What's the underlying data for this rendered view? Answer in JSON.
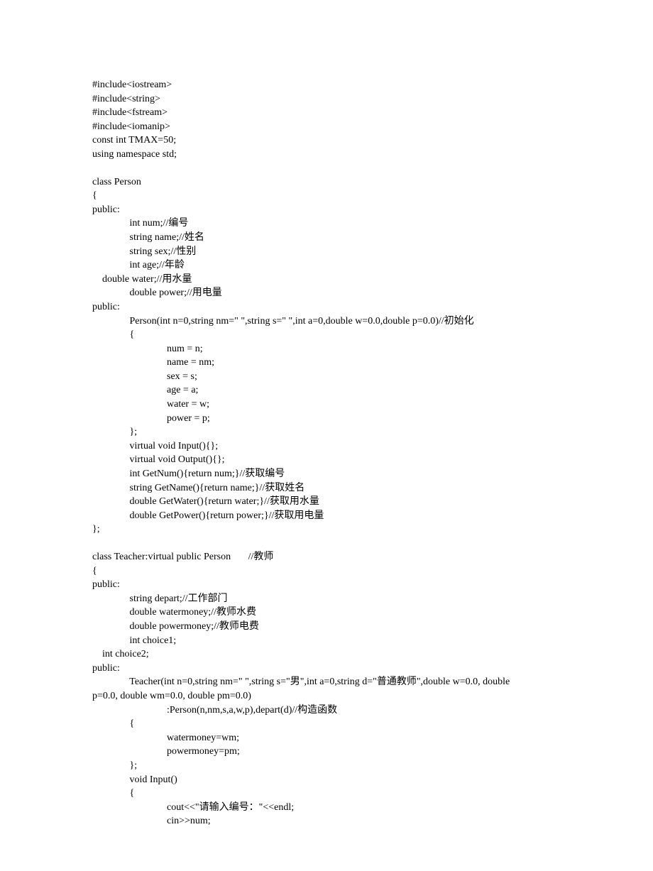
{
  "code_lines": [
    "#include<iostream>",
    "#include<string>",
    "#include<fstream>",
    "#include<iomanip>",
    "const int TMAX=50;",
    "using namespace std;",
    "",
    "class Person",
    "{",
    "public:",
    "               int num;//编号",
    "               string name;//姓名",
    "               string sex;//性别",
    "               int age;//年龄",
    "    double water;//用水量",
    "               double power;//用电量",
    "public:",
    "               Person(int n=0,string nm=\" \",string s=\" \",int a=0,double w=0.0,double p=0.0)//初始化",
    "               {",
    "                              num = n;",
    "                              name = nm;",
    "                              sex = s;",
    "                              age = a;",
    "                              water = w;",
    "                              power = p;",
    "               };",
    "               virtual void Input(){};",
    "               virtual void Output(){};",
    "               int GetNum(){return num;}//获取编号",
    "               string GetName(){return name;}//获取姓名",
    "               double GetWater(){return water;}//获取用水量",
    "               double GetPower(){return power;}//获取用电量",
    "};",
    "",
    "class Teacher:virtual public Person       //教师",
    "{",
    "public:",
    "               string depart;//工作部门",
    "               double watermoney;//教师水费",
    "               double powermoney;//教师电费",
    "               int choice1;",
    "    int choice2;",
    "public:",
    "               Teacher(int n=0,string nm=\" \",string s=\"男\",int a=0,string d=\"普通教师\",double w=0.0, double",
    "p=0.0, double wm=0.0, double pm=0.0)",
    "                              :Person(n,nm,s,a,w,p),depart(d)//构造函数",
    "               {",
    "                              watermoney=wm;",
    "                              powermoney=pm;",
    "               };",
    "               void Input()",
    "               {",
    "                              cout<<\"请输入编号：\"<<endl;",
    "                              cin>>num;"
  ]
}
